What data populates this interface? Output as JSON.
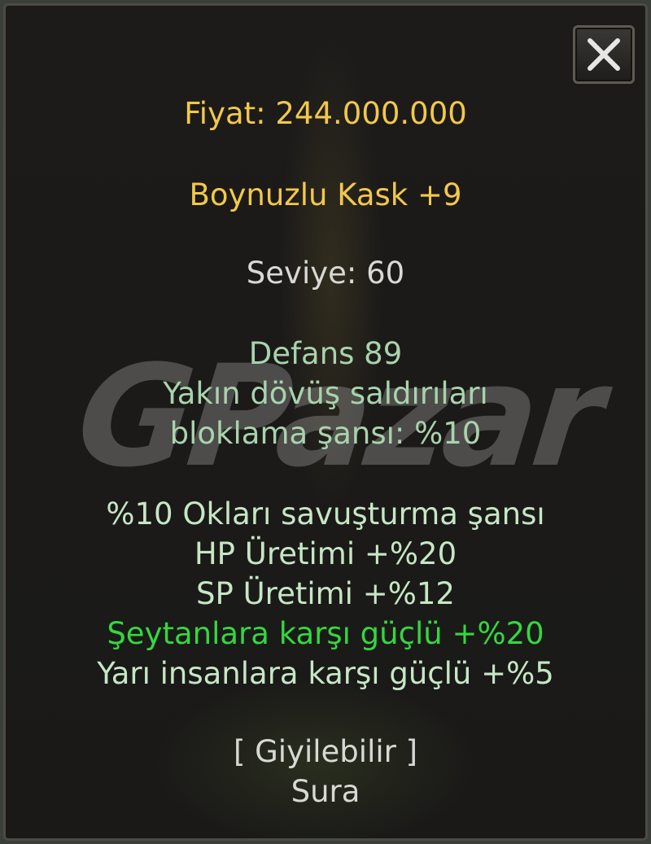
{
  "tooltip": {
    "price": "Fiyat: 244.000.000",
    "item_name": "Boynuzlu Kask +9",
    "level": "Seviye: 60",
    "stats": [
      "Defans 89",
      "Yakın dövüş saldırıları",
      "bloklama şansı: %10"
    ],
    "bonuses": [
      "%10 Okları savuşturma şansı",
      "HP Üretimi +%20",
      "SP Üretimi +%12",
      "Şeytanlara karşı güçlü +%20",
      "Yarı insanlara karşı güçlü +%5"
    ],
    "wearable": "[ Giyilebilir ]",
    "class": "Sura"
  },
  "watermark": "GPazar",
  "icons": {
    "close": "close-icon"
  },
  "colors": {
    "price": "#f2c84b",
    "name": "#f2c84b",
    "level": "#d8d8d4",
    "stats": "#a9d3ad",
    "bonus": "#c6e7c5",
    "highlight_bonus": "#35d640",
    "background": "#1c1b19"
  }
}
